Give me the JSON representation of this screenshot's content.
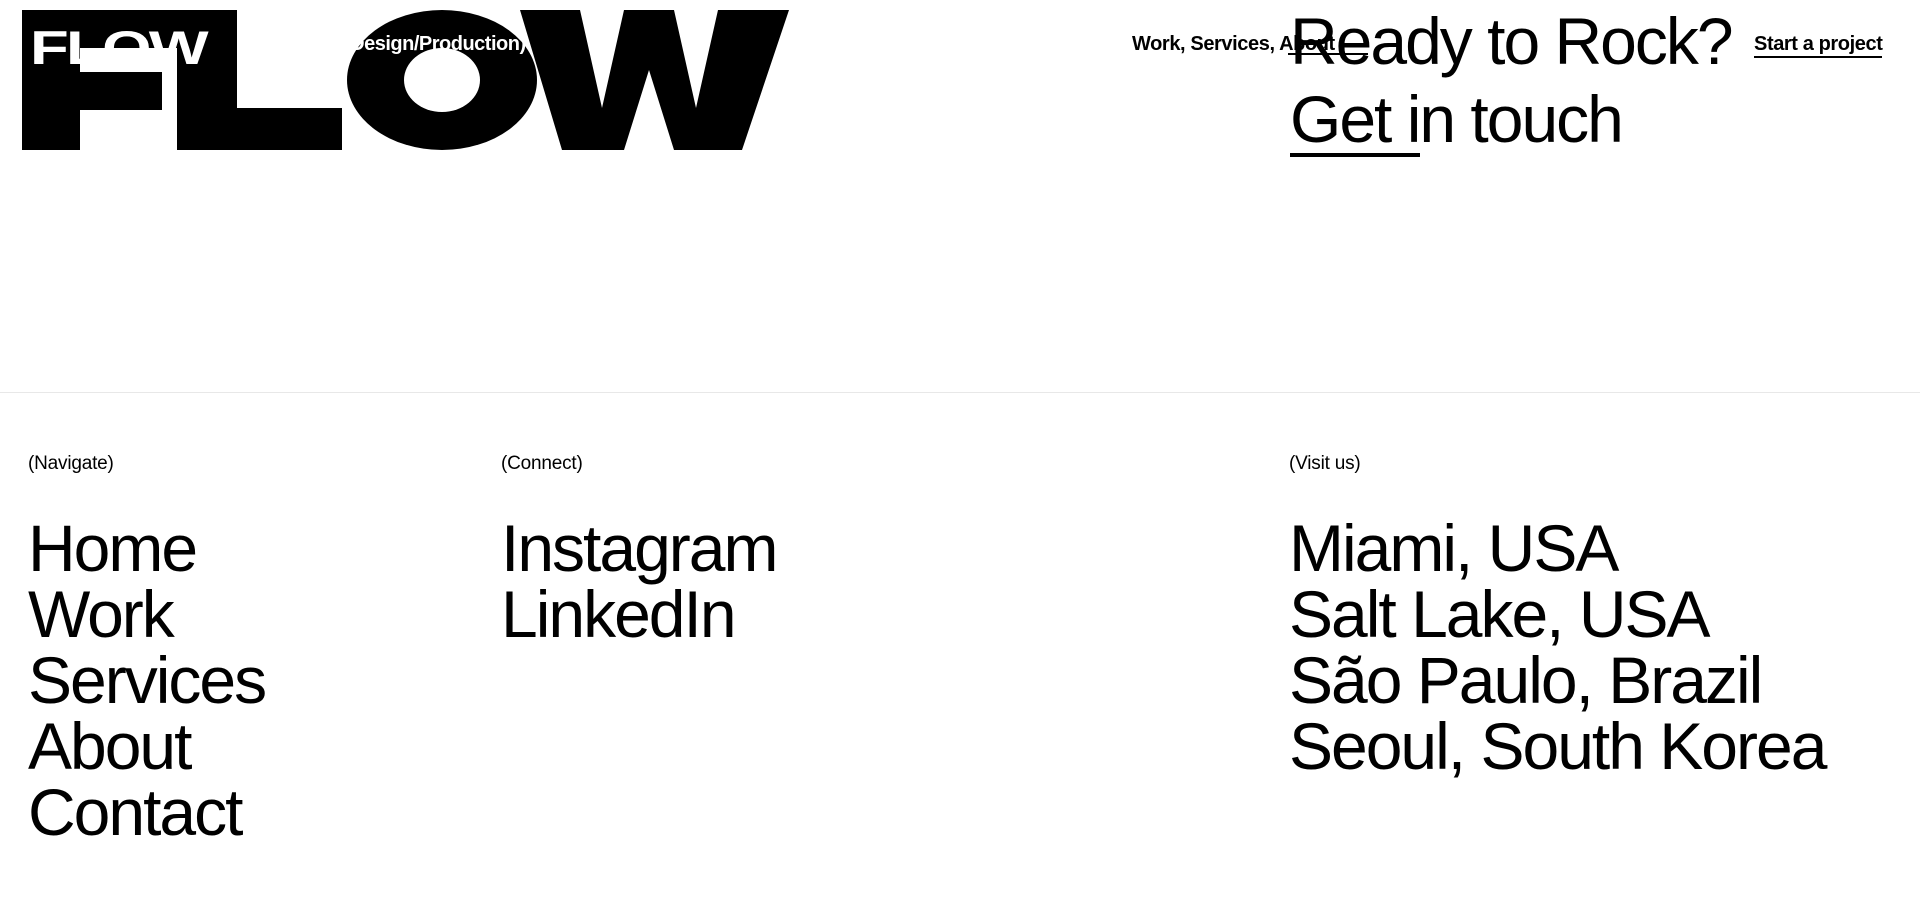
{
  "brand": {
    "logo_text": "FLOW",
    "big_wordmark": "FLOW",
    "tagline": "(Design/Production)"
  },
  "header": {
    "nav_links": [
      "Work,",
      "Services,",
      "About"
    ],
    "cta_title": "Ready to Rock?",
    "cta_link": "Get in touch",
    "start_project": "Start a project"
  },
  "footer": {
    "navigate": {
      "heading": "(Navigate)",
      "items": [
        "Home",
        "Work",
        "Services",
        "About",
        "Contact"
      ]
    },
    "connect": {
      "heading": "(Connect)",
      "items": [
        "Instagram",
        "LinkedIn"
      ]
    },
    "visit": {
      "heading": "(Visit us)",
      "items": [
        "Miami, USA",
        "Salt Lake, USA",
        "São Paulo, Brazil",
        "Seoul, South Korea"
      ]
    }
  },
  "colors": {
    "text": "#000000",
    "background": "#ffffff",
    "divider": "#e8e8e8"
  }
}
